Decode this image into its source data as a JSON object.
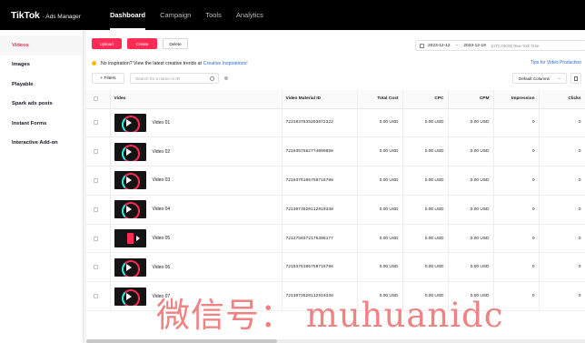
{
  "brand": {
    "name": "TikTok",
    "product": "· Ads Manager"
  },
  "nav": {
    "items": [
      {
        "label": "Dashboard"
      },
      {
        "label": "Campaign"
      },
      {
        "label": "Tools"
      },
      {
        "label": "Analytics"
      }
    ]
  },
  "sidebar": {
    "items": [
      {
        "label": "Videos"
      },
      {
        "label": "Images"
      },
      {
        "label": "Playable"
      },
      {
        "label": "Spark ads posts"
      },
      {
        "label": "Instant Forms"
      },
      {
        "label": "Interactive Add-on"
      }
    ]
  },
  "toolbar": {
    "upload": "Upload",
    "create": "Create",
    "delete": "Delete"
  },
  "date_range": {
    "start": "2023-12-12",
    "separator": "~",
    "end": "2023-12-19",
    "timezone": "(UTC-05:00) New York Time"
  },
  "info": {
    "text": "No inspiration? View the latest creative trends at",
    "link": "Creative Inspirations!",
    "tips": "Tips for Video Production"
  },
  "filters": {
    "label": "+ Filters",
    "search_placeholder": "Search for a name or ID",
    "columns": "Default Columns"
  },
  "table": {
    "headers": {
      "video": "Video",
      "material_id": "Video Material ID",
      "total_cost": "Total Cost",
      "cpc": "CPC",
      "cpm": "CPM",
      "impression": "Impression",
      "clicks": "Clicks"
    },
    "rows": [
      {
        "name": "Video 01",
        "id": "7231937835263672322",
        "cost": "0.00 USD",
        "cpc": "0.00 USD",
        "cpm": "0.00 USD",
        "impression": "0",
        "clicks": "0"
      },
      {
        "name": "Video 02",
        "id": "7219357582774009858",
        "cost": "0.00 USD",
        "cpc": "0.00 USD",
        "cpm": "0.00 USD",
        "impression": "0",
        "clicks": "0"
      },
      {
        "name": "Video 03",
        "id": "7219376106759716786",
        "cost": "0.00 USD",
        "cpc": "0.00 USD",
        "cpm": "0.00 USD",
        "impression": "0",
        "clicks": "0"
      },
      {
        "name": "Video 04",
        "id": "7213073520112910338",
        "cost": "0.00 USD",
        "cpc": "0.00 USD",
        "cpm": "0.00 USD",
        "impression": "0",
        "clicks": "0"
      },
      {
        "name": "Video 05",
        "id": "7212750372176306177",
        "cost": "0.00 USD",
        "cpc": "0.00 USD",
        "cpm": "0.00 USD",
        "impression": "0",
        "clicks": "0"
      },
      {
        "name": "Video 06",
        "id": "7219376106759716786",
        "cost": "0.00 USD",
        "cpc": "0.00 USD",
        "cpm": "0.00 USD",
        "impression": "0",
        "clicks": "0"
      },
      {
        "name": "Video 07",
        "id": "7213073520112910338",
        "cost": "0.00 USD",
        "cpc": "0.00 USD",
        "cpm": "0.00 USD",
        "impression": "0",
        "clicks": "0"
      }
    ]
  },
  "watermark": "微信号： muhuanidc",
  "colors": {
    "accent": "#fe2c55",
    "link": "#2b6bd6",
    "topbar": "#000000"
  }
}
